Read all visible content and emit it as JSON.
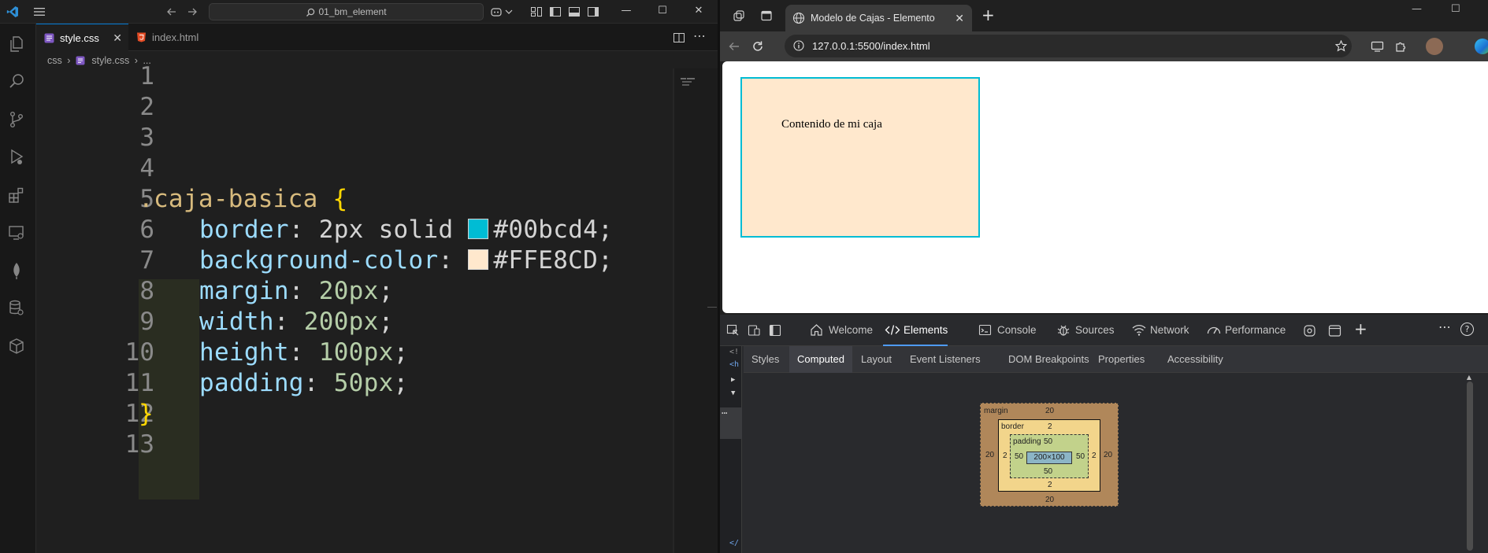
{
  "vscode": {
    "search": "01_bm_element",
    "tabs": [
      {
        "label": "style.css",
        "active": true
      },
      {
        "label": "index.html",
        "active": false
      }
    ],
    "breadcrumb": [
      "css",
      "style.css",
      "..."
    ],
    "line_numbers": [
      "1",
      "2",
      "3",
      "4",
      "5",
      "6",
      "7",
      "8",
      "9",
      "10",
      "11",
      "12",
      "13"
    ],
    "code": {
      "selector": ".caja-basica",
      "open_brace": "{",
      "close_brace": "}",
      "rules": [
        {
          "prop": "border",
          "value": "2px solid",
          "color": "#00bcd4",
          "end": ";"
        },
        {
          "prop": "background-color",
          "value": "",
          "color": "#FFE8CD",
          "end": ";"
        },
        {
          "prop": "margin",
          "value": "20px",
          "end": ";"
        },
        {
          "prop": "width",
          "value": "200px",
          "end": ";"
        },
        {
          "prop": "height",
          "value": "100px",
          "end": ";"
        },
        {
          "prop": "padding",
          "value": "50px",
          "end": ";"
        }
      ]
    }
  },
  "browser": {
    "tab_title": "Modelo de Cajas - Elemento",
    "url": "127.0.0.1:5500/index.html",
    "page_text": "Contenido de mi caja",
    "devtools": {
      "tabs": [
        "Welcome",
        "Elements",
        "Console",
        "Sources",
        "Network",
        "Performance"
      ],
      "active_tab": "Elements",
      "subtabs": [
        "Styles",
        "Computed",
        "Layout",
        "Event Listeners",
        "DOM Breakpoints",
        "Properties",
        "Accessibility"
      ],
      "active_subtab": "Computed",
      "box_model": {
        "margin_label": "margin",
        "border_label": "border",
        "padding_label": "padding",
        "margin": {
          "top": "20",
          "right": "20",
          "bottom": "20",
          "left": "20"
        },
        "border": {
          "top": "2",
          "right": "2",
          "bottom": "2",
          "left": "2"
        },
        "padding": {
          "top": "50",
          "right": "50",
          "bottom": "50",
          "left": "50"
        },
        "content": "200×100"
      }
    }
  },
  "colors": {
    "accent_border": "#00bcd4",
    "box_background": "#FFE8CD",
    "vscode_accent": "#0078d4",
    "devtools_active": "#4e9bf5"
  }
}
